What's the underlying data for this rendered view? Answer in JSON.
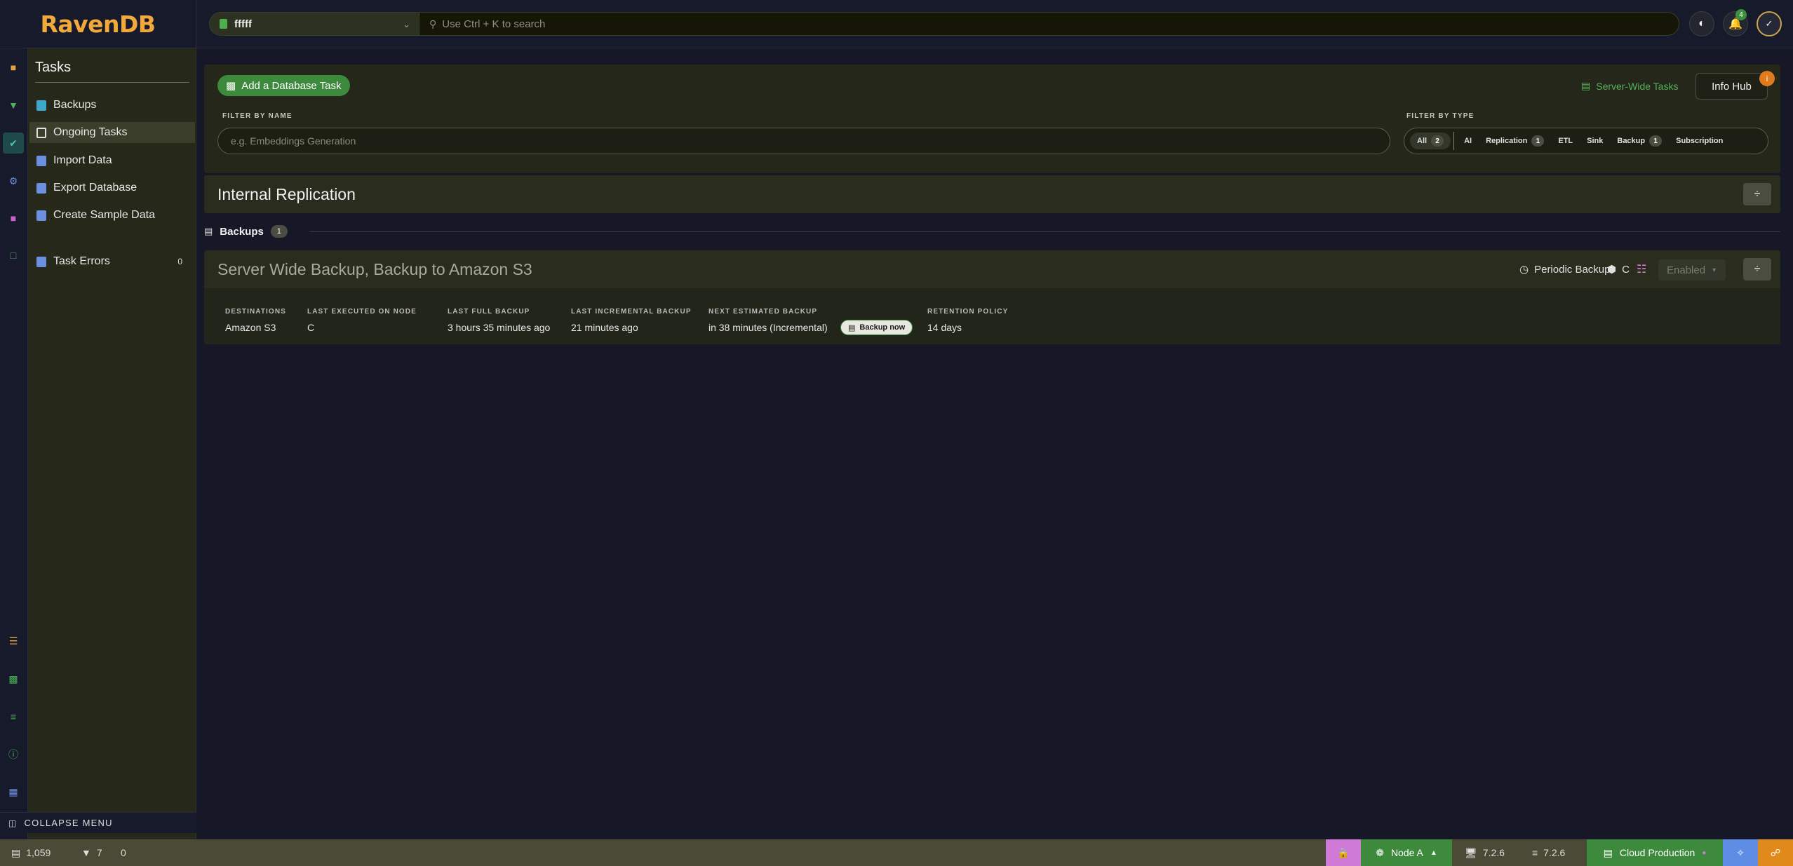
{
  "app": {
    "logo": "RavenDB"
  },
  "topbar": {
    "database": "fffff",
    "search_placeholder": "Use Ctrl + K to search",
    "notifications_count": "4",
    "icons": [
      "theme-toggle-icon",
      "bell-icon",
      "profile-icon"
    ]
  },
  "rail": {
    "icons": [
      "documents-icon",
      "indexes-icon",
      "tasks-icon",
      "settings-icon",
      "stats-icon",
      "chart-icon",
      "storage-icon",
      "migrate-icon",
      "cluster-icon",
      "info-icon",
      "docs-icon"
    ]
  },
  "menu": {
    "title": "Tasks",
    "items": [
      {
        "label": "Backups",
        "color": "#3fa7c9"
      },
      {
        "label": "Ongoing Tasks",
        "color": "#e0e0e0"
      },
      {
        "label": "Import Data",
        "color": "#6d8fe0"
      },
      {
        "label": "Export Database",
        "color": "#6d8fe0"
      },
      {
        "label": "Create Sample Data",
        "color": "#6d8fe0"
      }
    ],
    "task_errors": {
      "label": "Task Errors",
      "count": "0"
    },
    "collapse_label": "COLLAPSE MENU"
  },
  "filters": {
    "add_task_label": "Add a Database Task",
    "server_wide_label": "Server-Wide Tasks",
    "info_hub_label": "Info Hub",
    "info_hub_badge": "i",
    "by_name_label": "FILTER BY NAME",
    "by_name_placeholder": "e.g. Embeddings Generation",
    "by_type_label": "FILTER BY TYPE",
    "types": [
      {
        "label": "All",
        "count": "2"
      },
      {
        "label": "AI",
        "count": ""
      },
      {
        "label": "Replication",
        "count": "1"
      },
      {
        "label": "ETL",
        "count": ""
      },
      {
        "label": "Sink",
        "count": ""
      },
      {
        "label": "Backup",
        "count": "1"
      },
      {
        "label": "Subscription",
        "count": ""
      }
    ]
  },
  "internal_replication": {
    "title": "Internal Replication"
  },
  "backups_section": {
    "label": "Backups",
    "count": "1"
  },
  "task": {
    "title": "Server Wide Backup, Backup to Amazon S3",
    "type_label": "Periodic Backup",
    "node": "C",
    "state": "Enabled",
    "details": {
      "destinations": {
        "label": "DESTINATIONS",
        "value": "Amazon S3"
      },
      "last_node": {
        "label": "LAST EXECUTED ON NODE",
        "value": "C"
      },
      "last_full": {
        "label": "LAST FULL BACKUP",
        "value": "3 hours 35 minutes ago"
      },
      "last_incremental": {
        "label": "LAST INCREMENTAL BACKUP",
        "value": "21 minutes ago"
      },
      "next_estimated": {
        "label": "NEXT ESTIMATED BACKUP",
        "value": "in 38 minutes (Incremental)"
      },
      "retention": {
        "label": "RETENTION POLICY",
        "value": "14 days"
      }
    },
    "backup_now_label": "Backup now"
  },
  "statusbar": {
    "documents": "1,059",
    "indexes": "7",
    "errors": "0",
    "node_label": "Node A",
    "client_version": "7.2.6",
    "server_version": "7.2.6",
    "environment": "Cloud Production",
    "colors": {
      "lock": "#cf7ad6",
      "node": "#3d8a3c",
      "cloud": "#3d8a3c",
      "network": "#5f8de6",
      "support": "#e08a1c"
    }
  }
}
